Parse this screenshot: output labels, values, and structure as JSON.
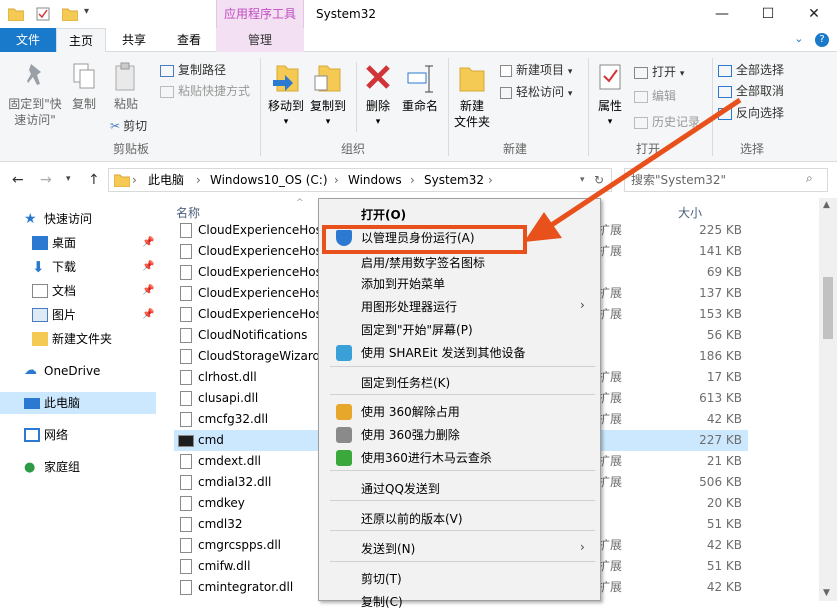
{
  "window": {
    "title": "System32",
    "contextual_tab_title": "应用程序工具",
    "controls": {
      "minimize": "—",
      "maximize": "☐",
      "close": "✕"
    }
  },
  "tabs": [
    {
      "label": "文件"
    },
    {
      "label": "主页"
    },
    {
      "label": "共享"
    },
    {
      "label": "查看"
    },
    {
      "label": "管理"
    }
  ],
  "ribbon": {
    "clipboard": {
      "label": "剪贴板",
      "pin": "固定到\"快\n速访问\"",
      "copy": "复制",
      "paste": "粘贴",
      "copy_path": "复制路径",
      "paste_shortcut": "粘贴快捷方式",
      "cut": "剪切"
    },
    "organize": {
      "label": "组织",
      "move_to": "移动到",
      "copy_to": "复制到",
      "delete": "删除",
      "rename": "重命名"
    },
    "new": {
      "label": "新建",
      "new_folder": "新建\n文件夹",
      "new_item": "新建项目",
      "easy_access": "轻松访问"
    },
    "open": {
      "label": "打开",
      "properties": "属性",
      "open": "打开",
      "edit": "编辑",
      "history": "历史记录"
    },
    "select": {
      "label": "选择",
      "select_all": "全部选择",
      "select_none": "全部取消",
      "invert": "反向选择"
    }
  },
  "address": {
    "crumbs": [
      "此电脑",
      "Windows10_OS (C:)",
      "Windows",
      "System32"
    ],
    "search_placeholder": "搜索\"System32\""
  },
  "nav_pane": [
    {
      "label": "快速访问",
      "icon": "star-icon"
    },
    {
      "label": "桌面",
      "icon": "desktop-icon"
    },
    {
      "label": "下载",
      "icon": "download-icon"
    },
    {
      "label": "文档",
      "icon": "document-icon"
    },
    {
      "label": "图片",
      "icon": "picture-icon"
    },
    {
      "label": "新建文件夹",
      "icon": "folder-icon"
    },
    {
      "label": "OneDrive",
      "icon": "cloud-icon"
    },
    {
      "label": "此电脑",
      "icon": "computer-icon"
    },
    {
      "label": "网络",
      "icon": "network-icon"
    },
    {
      "label": "家庭组",
      "icon": "homegroup-icon"
    }
  ],
  "columns": {
    "name": "名称",
    "size": "大小"
  },
  "files": [
    {
      "name": "CloudExperienceHos",
      "type": "扩展",
      "size": "225 KB"
    },
    {
      "name": "CloudExperienceHos",
      "type": "扩展",
      "size": "141 KB"
    },
    {
      "name": "CloudExperienceHostE",
      "type": "",
      "size": "69 KB"
    },
    {
      "name": "CloudExperienceHostC",
      "type": "扩展",
      "size": "137 KB"
    },
    {
      "name": "CloudExperienceHostU",
      "type": "扩展",
      "size": "153 KB"
    },
    {
      "name": "CloudNotifications",
      "type": "",
      "size": "56 KB"
    },
    {
      "name": "CloudStorageWizard",
      "type": "",
      "size": "186 KB"
    },
    {
      "name": "clrhost.dll",
      "type": "扩展",
      "size": "17 KB"
    },
    {
      "name": "clusapi.dll",
      "type": "扩展",
      "size": "613 KB"
    },
    {
      "name": "cmcfg32.dll",
      "type": "扩展",
      "size": "42 KB"
    },
    {
      "name": "cmd",
      "type": "",
      "size": "227 KB"
    },
    {
      "name": "cmdext.dll",
      "type": "扩展",
      "size": "21 KB"
    },
    {
      "name": "cmdial32.dll",
      "type": "扩展",
      "size": "506 KB"
    },
    {
      "name": "cmdkey",
      "type": "",
      "size": "20 KB"
    },
    {
      "name": "cmdl32",
      "type": "",
      "size": "51 KB"
    },
    {
      "name": "cmgrcspps.dll",
      "type": "扩展",
      "size": "42 KB"
    },
    {
      "name": "cmifw.dll",
      "type": "扩展",
      "size": "51 KB"
    },
    {
      "name": "cmintegrator.dll",
      "type": "扩展",
      "size": "42 KB"
    }
  ],
  "context_menu": [
    {
      "label": "打开(O)",
      "bold": true
    },
    {
      "label": "以管理员身份运行(A)",
      "icon": "shield-icon"
    },
    {
      "label": "启用/禁用数字签名图标"
    },
    {
      "label": "添加到开始菜单"
    },
    {
      "label": "用图形处理器运行",
      "submenu": true
    },
    {
      "label": "固定到\"开始\"屏幕(P)"
    },
    {
      "label": "使用 SHAREit 发送到其他设备",
      "icon": "shareit-icon"
    },
    {
      "label": "固定到任务栏(K)"
    },
    {
      "label": "使用 360解除占用",
      "icon": "unlock-360-icon"
    },
    {
      "label": "使用 360强力删除",
      "icon": "shred-360-icon"
    },
    {
      "label": "使用360进行木马云查杀",
      "icon": "scan-360-icon"
    },
    {
      "label": "通过QQ发送到"
    },
    {
      "label": "还原以前的版本(V)"
    },
    {
      "label": "发送到(N)",
      "submenu": true
    },
    {
      "label": "剪切(T)"
    },
    {
      "label": "复制(C)"
    }
  ],
  "colors": {
    "accent": "#1979ca",
    "annotation": "#e8501c",
    "selection": "#cce8ff",
    "contextual_tab": "#f3e0f3"
  }
}
